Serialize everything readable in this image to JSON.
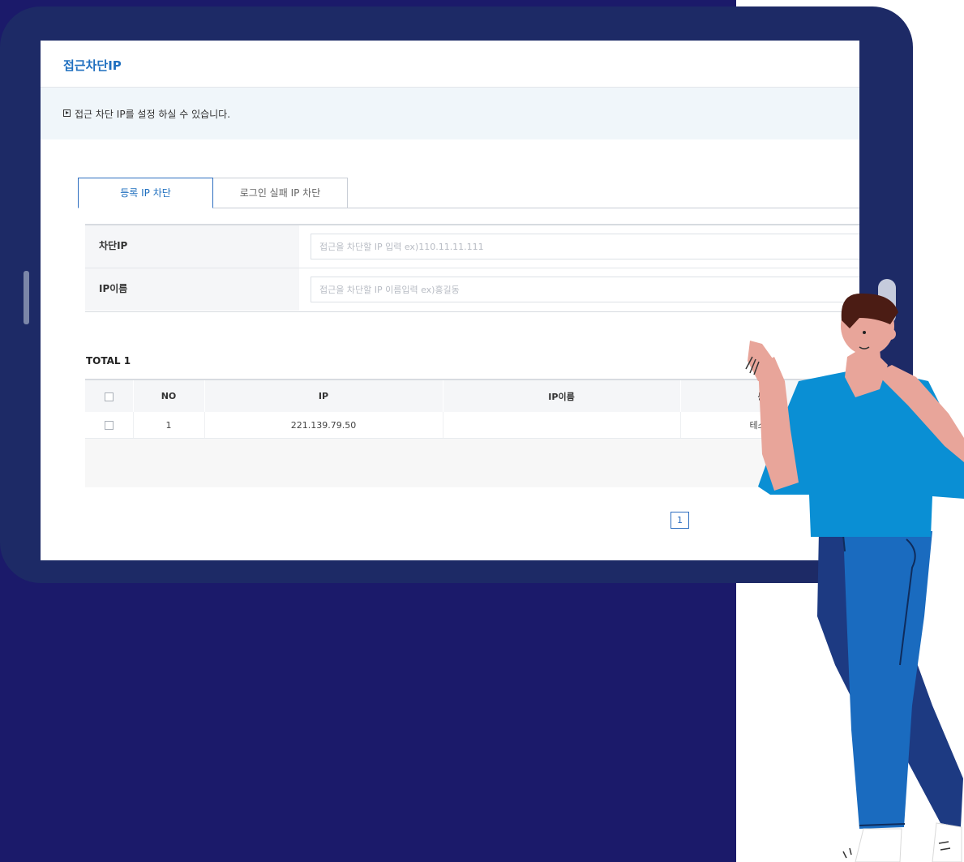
{
  "page": {
    "title": "접근차단IP",
    "notice": "접근 차단 IP를 설정 하실 수 있습니다."
  },
  "tabs": [
    {
      "label": "등록 IP 차단",
      "active": true
    },
    {
      "label": "로그인 실패 IP 차단",
      "active": false
    }
  ],
  "form": {
    "block_ip": {
      "label": "차단IP",
      "placeholder": "접근을 차단할 IP 입력 ex)110.11.11.111",
      "value": ""
    },
    "ip_name": {
      "label": "IP이름",
      "placeholder": "접근을 차단할 IP 이름입력 ex)홍길동",
      "value": ""
    }
  },
  "list": {
    "total_label": "TOTAL 1",
    "columns": [
      "NO",
      "IP",
      "IP이름",
      "등록자"
    ],
    "rows": [
      {
        "no": "1",
        "ip": "221.139.79.50",
        "ip_name": "",
        "registrant": "테스트디비"
      }
    ]
  },
  "pagination": {
    "current_page": "1"
  },
  "colors": {
    "background": "#1b1a6a",
    "tablet_frame": "#1d2a66",
    "accent": "#1f6fbf",
    "shirt": "#0a8fd4",
    "pants": "#1a6bbf"
  }
}
